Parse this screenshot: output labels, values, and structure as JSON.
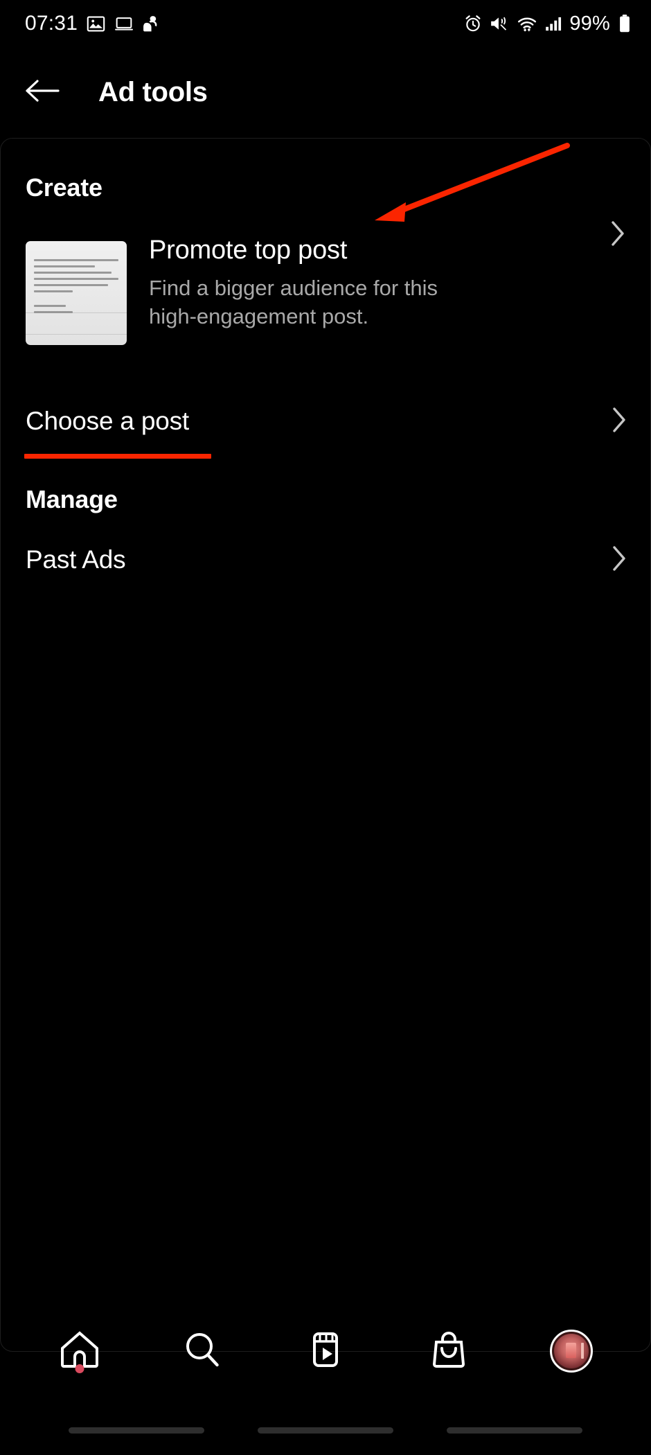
{
  "status_bar": {
    "time": "07:31",
    "battery_percent": "99%",
    "left_icons": [
      "gallery-icon",
      "laptop-icon",
      "person-icon"
    ],
    "right_icons": [
      "alarm-icon",
      "vibrate-icon",
      "wifi-icon",
      "cellular-signal-icon",
      "battery-icon"
    ]
  },
  "header": {
    "back_icon": "back-arrow-icon",
    "title": "Ad tools"
  },
  "sections": {
    "create": {
      "title": "Create",
      "promote": {
        "title": "Promote top post",
        "subtitle": "Find a bigger audience for this high-engagement post.",
        "thumbnail": "post-thumbnail",
        "chevron": "chevron-right-icon"
      },
      "choose_post": {
        "label": "Choose a post",
        "chevron": "chevron-right-icon"
      }
    },
    "manage": {
      "title": "Manage",
      "past_ads": {
        "label": "Past Ads",
        "chevron": "chevron-right-icon"
      }
    }
  },
  "annotations": {
    "arrow_color": "#fb2500",
    "underline_color": "#fb2500",
    "arrow_target": "Promote top post",
    "underline_target": "Choose a post"
  },
  "bottom_nav": {
    "items": [
      {
        "name": "home",
        "icon": "home-icon",
        "badge": true
      },
      {
        "name": "search",
        "icon": "search-icon",
        "badge": false
      },
      {
        "name": "reels",
        "icon": "reels-icon",
        "badge": false
      },
      {
        "name": "shop",
        "icon": "shop-bag-icon",
        "badge": false
      },
      {
        "name": "profile",
        "icon": "profile-avatar",
        "badge": false
      }
    ]
  },
  "colors": {
    "background": "#000000",
    "primary_text": "#ffffff",
    "secondary_text": "#a9a9a9",
    "accent_red": "#fb2500",
    "badge_red": "#d94a5e"
  }
}
